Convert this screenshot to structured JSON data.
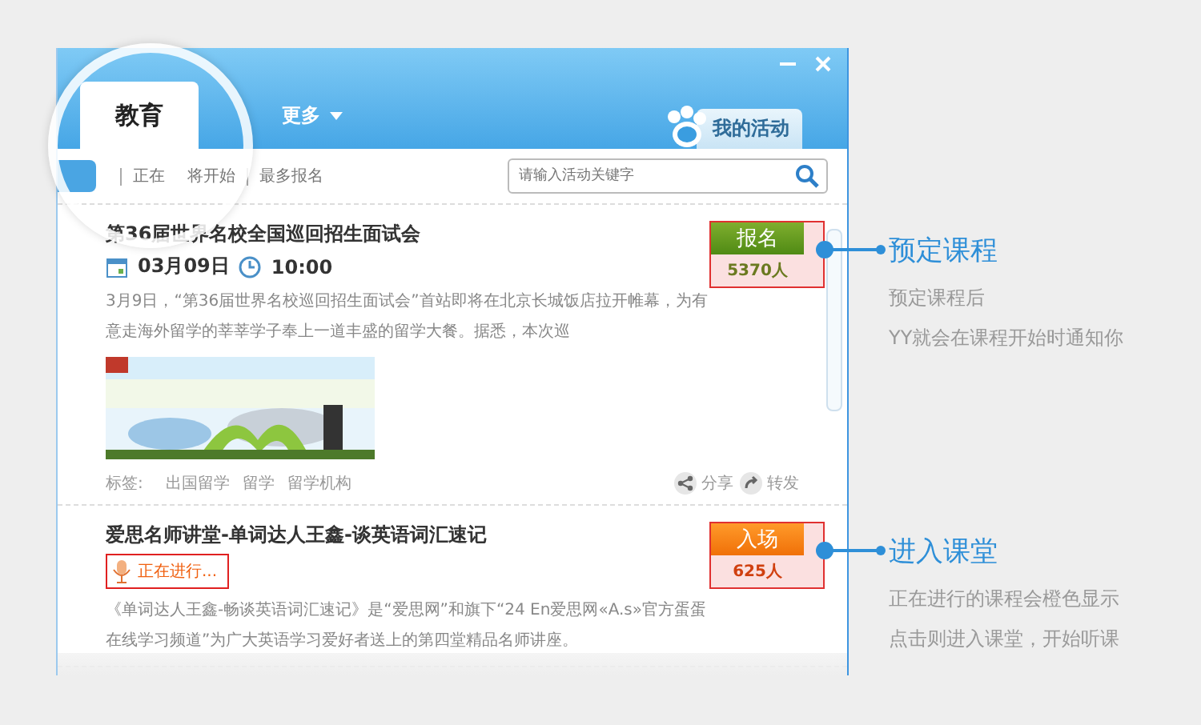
{
  "window": {
    "tabs": [
      {
        "label": "教育",
        "selected": true
      },
      {
        "label": "更多",
        "selected": false
      }
    ],
    "my_activity": "我的活动"
  },
  "filters": [
    {
      "label": "正在",
      "selected": false
    },
    {
      "label": "将开始",
      "selected": false
    },
    {
      "label": "最多报名",
      "selected": false
    }
  ],
  "search": {
    "placeholder": "请输入活动关键字"
  },
  "events": [
    {
      "kind": "scheduled",
      "title": "第36届世界名校全国巡回招生面试会",
      "date": "03月09日",
      "time": "10:00",
      "description": "3月9日，“第36届世界名校巡回招生面试会”首站即将在北京长城饭店拉开帷幕，为有意走海外留学的莘莘学子奉上一道丰盛的留学大餐。据悉，本次巡",
      "picture": {
        "kind": "picture"
      },
      "tags_label": "标签:",
      "tags": [
        "出国留学",
        "留学",
        "留学机构"
      ],
      "actions": [
        "分享",
        "转发"
      ],
      "button": "报名",
      "count": "5370人"
    },
    {
      "kind": "live",
      "title": "爱思名师讲堂-单词达人王鑫-谈英语词汇速记",
      "status": "正在进行...",
      "description": "《单词达人王鑫-畅谈英语词汇速记》是“爱思网”和旗下“24 En爱思网«A.s»官方蛋蛋在线学习频道”为广大英语学习爱好者送上的第四堂精品名师讲座。",
      "button": "入场",
      "count": "625人"
    }
  ],
  "callouts": [
    {
      "title": "预定课程",
      "lines": [
        "预定课程后",
        "YY就会在课程开始时通知你"
      ]
    },
    {
      "title": "进入课堂",
      "lines": [
        "正在进行的课程会橙色显示",
        "点击则进入课堂，开始听课"
      ]
    }
  ]
}
